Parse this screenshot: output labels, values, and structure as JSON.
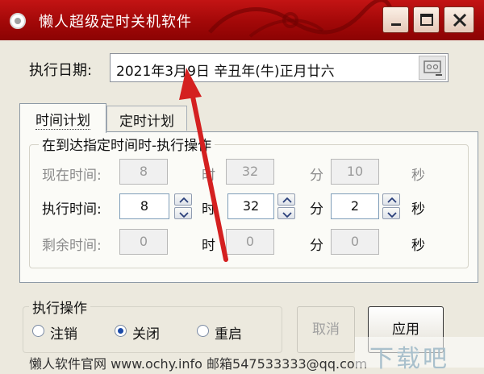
{
  "window": {
    "title": "懒人超级定时关机软件",
    "icons": {
      "app": "app-icon",
      "minimize": "minimize-icon",
      "maximize": "maximize-icon",
      "close": "close-icon"
    }
  },
  "date": {
    "label": "执行日期:",
    "value": "2021年3月9日 辛丑年(牛)正月廿六"
  },
  "tabs": [
    {
      "label": "时间计划",
      "active": true
    },
    {
      "label": "定时计划",
      "active": false
    }
  ],
  "group": {
    "title": "在到达指定时间时-执行操作",
    "units": {
      "hour": "时",
      "minute": "分",
      "second": "秒"
    },
    "rows": [
      {
        "label": "现在时间:",
        "hour": "8",
        "minute": "32",
        "second": "10",
        "enabled": false
      },
      {
        "label": "执行时间:",
        "hour": "8",
        "minute": "32",
        "second": "2",
        "enabled": true
      },
      {
        "label": "剩余时间:",
        "hour": "0",
        "minute": "0",
        "second": "0",
        "enabled": false
      }
    ]
  },
  "action": {
    "title": "执行操作",
    "options": [
      {
        "label": "注销",
        "checked": false
      },
      {
        "label": "关闭",
        "checked": true
      },
      {
        "label": "重启",
        "checked": false
      }
    ]
  },
  "buttons": {
    "cancel": "取消",
    "apply": "应用"
  },
  "footer": "懒人软件官网 www.ochy.info 邮箱547533333@qq.com",
  "watermark": "下载吧",
  "colors": {
    "titlebar": "#b10d0d",
    "arrow": "#d42020",
    "window_bg": "#ece9de",
    "panel_bg": "#fbfbf7"
  }
}
